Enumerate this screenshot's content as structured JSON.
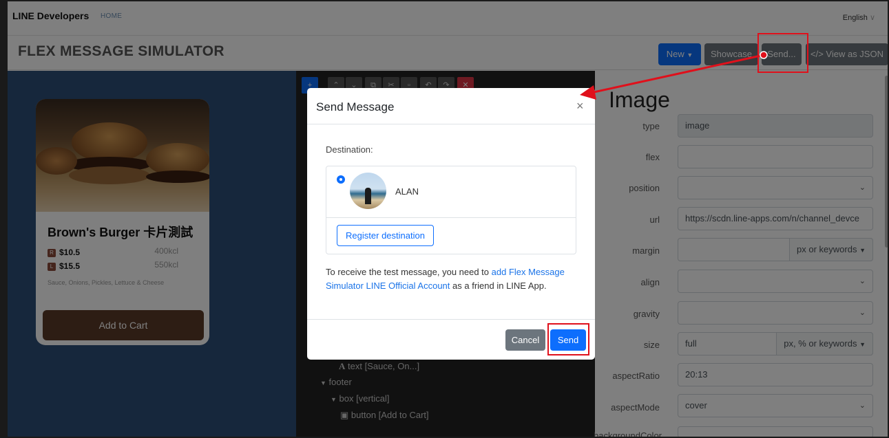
{
  "topnav": {
    "brand_line": "LINE",
    "brand_dev": "Developers",
    "home": "HOME",
    "language": "English"
  },
  "header": {
    "title": "FLEX MESSAGE SIMULATOR",
    "new_label": "New",
    "showcase_label": "Showcase",
    "send_label": "Send...",
    "json_label": "</> View as JSON"
  },
  "card": {
    "title": "Brown's Burger 卡片測試",
    "prices": [
      {
        "tag": "R",
        "price": "$10.5",
        "kcal": "400kcl"
      },
      {
        "tag": "L",
        "price": "$15.5",
        "kcal": "550kcl"
      }
    ],
    "description": "Sauce, Onions, Pickles, Lettuce & Cheese",
    "button": "Add to Cart"
  },
  "tree": {
    "items": [
      "text [Sauce, On...]",
      "footer",
      "box [vertical]",
      "button [Add to Cart]"
    ]
  },
  "props": {
    "heading": "Image",
    "rows": [
      {
        "label": "type",
        "value": ""
      },
      {
        "label": "flex",
        "value": ""
      },
      {
        "label": "position",
        "value": ""
      },
      {
        "label": "url",
        "value": "https://scdn.line-apps.com/n/channel_devce"
      },
      {
        "label": "margin",
        "value": "",
        "addon": "px or keywords"
      },
      {
        "label": "align",
        "value": ""
      },
      {
        "label": "gravity",
        "value": ""
      },
      {
        "label": "size",
        "value": "full",
        "addon": "px, % or keywords"
      },
      {
        "label": "aspectRatio",
        "value": "20:13"
      },
      {
        "label": "aspectMode",
        "value": "cover"
      },
      {
        "label": "backgroundColor",
        "value": ""
      }
    ],
    "type_value": "image"
  },
  "modal": {
    "title": "Send Message",
    "destination_label": "Destination:",
    "recipient_name": "ALAN",
    "register_label": "Register destination",
    "note_prefix": "To receive the test message, you need to ",
    "note_link": "add Flex Message Simulator LINE Official Account",
    "note_suffix": " as a friend in LINE App.",
    "cancel_label": "Cancel",
    "send_label": "Send"
  },
  "colors": {
    "primary": "#0d6efd",
    "secondary": "#6c757d",
    "annotation": "#e0101b",
    "card_button": "#5a3a28"
  }
}
